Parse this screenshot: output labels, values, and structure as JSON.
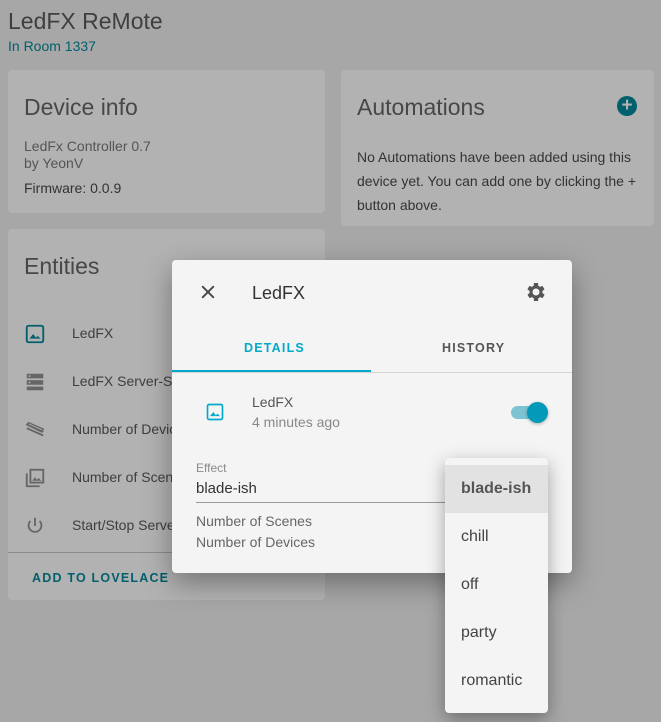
{
  "page": {
    "title": "LedFX ReMote",
    "subtitle": "In Room 1337"
  },
  "device_info": {
    "title": "Device info",
    "model": "LedFx Controller 0.7",
    "manufacturer": "by YeonV",
    "firmware": "Firmware: 0.0.9"
  },
  "automations": {
    "title": "Automations",
    "add_icon": "plus-circle-icon",
    "text_line1": "No Automations have been added using this",
    "text_line2": "device yet. You can add one by clicking the +",
    "text_line3": "button above."
  },
  "entities": {
    "title": "Entities",
    "items": [
      {
        "label": "LedFX",
        "icon": "image-icon"
      },
      {
        "label": "LedFX Server-St",
        "icon": "server-icon"
      },
      {
        "label": "Number of Devic",
        "icon": "led-strip-icon"
      },
      {
        "label": "Number of Scen",
        "icon": "image-multiple-icon"
      },
      {
        "label": "Start/Stop Serve",
        "icon": "power-icon"
      }
    ],
    "add_to_lovelace": "ADD TO LOVELACE"
  },
  "dialog": {
    "title": "LedFX",
    "tabs": [
      {
        "label": "DETAILS",
        "active": true
      },
      {
        "label": "HISTORY",
        "active": false
      }
    ],
    "entity_name": "LedFX",
    "last_changed": "4 minutes ago",
    "toggle_on": true,
    "effect_label": "Effect",
    "effect_value": "blade-ish",
    "attributes": [
      "Number of Scenes",
      "Number of Devices"
    ]
  },
  "dropdown": {
    "options": [
      "blade-ish",
      "chill",
      "off",
      "party",
      "romantic"
    ],
    "selected": "blade-ish"
  },
  "colors": {
    "accent": "#03a9c9",
    "accent_dark": "#025f6d",
    "overlay_bg": "#a7a7a7",
    "dialog_bg": "#f4f4f4"
  }
}
